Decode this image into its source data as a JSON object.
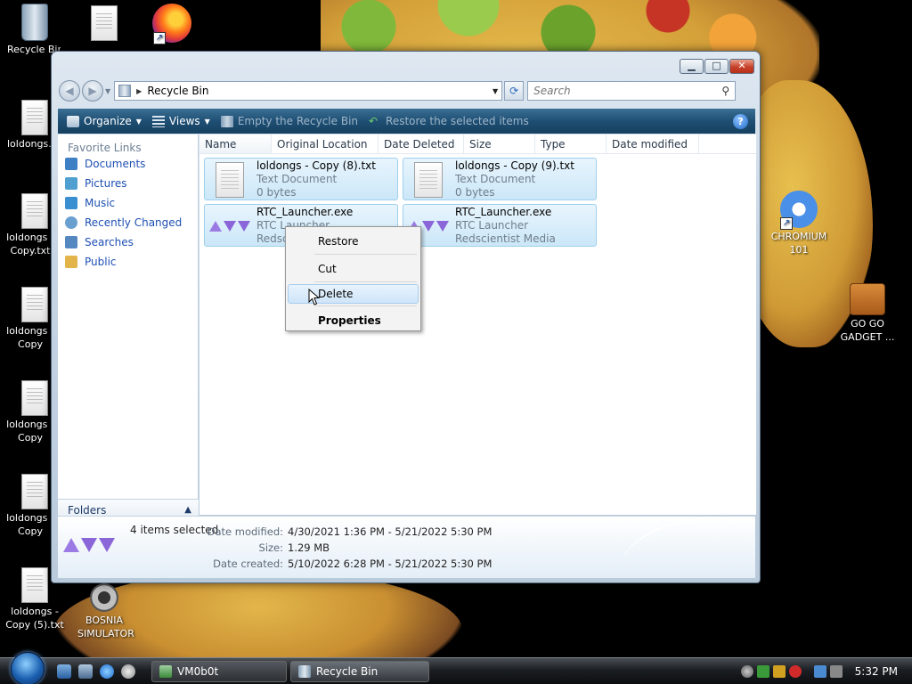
{
  "desktop": {
    "icons": [
      {
        "label": "Recycle Bin"
      },
      {
        "label": "loldongs.txt"
      },
      {
        "label": "loldongs - Copy.txt"
      },
      {
        "label": "loldongs - Copy (2).txt"
      },
      {
        "label": "loldongs - Copy (3).txt"
      },
      {
        "label": "loldongs - Copy (4).txt"
      },
      {
        "label": "loldongs - Copy (5).txt"
      },
      {
        "label": "BOSNIA SIMULATOR"
      },
      {
        "label": "CHROMIUM 101"
      },
      {
        "label": "GO GO GADGET ..."
      }
    ]
  },
  "window": {
    "title": "Recycle Bin",
    "controls": {
      "minimize": "▁",
      "maximize": "□",
      "close": "✕"
    },
    "address": {
      "location": "Recycle Bin"
    },
    "search": {
      "placeholder": "Search"
    },
    "toolbar": {
      "organize": "Organize",
      "views": "Views",
      "empty": "Empty the Recycle Bin",
      "restore": "Restore the selected items",
      "help": "?"
    },
    "nav_pane": {
      "title": "Favorite Links",
      "items": [
        {
          "label": "Documents",
          "color": "#3f7fc4"
        },
        {
          "label": "Pictures",
          "color": "#4f9fd0"
        },
        {
          "label": "Music",
          "color": "#3a8fd0"
        },
        {
          "label": "Recently Changed",
          "color": "#6aa0cf"
        },
        {
          "label": "Searches",
          "color": "#5588c0"
        },
        {
          "label": "Public",
          "color": "#e2b44a"
        }
      ],
      "folders_label": "Folders"
    },
    "columns": [
      "Name",
      "Original Location",
      "Date Deleted",
      "Size",
      "Type",
      "Date modified"
    ],
    "files": [
      {
        "name": "loldongs - Copy (8).txt",
        "type": "Text Document",
        "detail": "0 bytes"
      },
      {
        "name": "loldongs - Copy (9).txt",
        "type": "Text Document",
        "detail": "0 bytes"
      },
      {
        "name": "RTC_Launcher.exe",
        "type": "RTC Launcher",
        "detail": "Redscientist Media"
      },
      {
        "name": "RTC_Launcher.exe",
        "type": "RTC Launcher",
        "detail": "Redscientist Media"
      }
    ],
    "details": {
      "count": "4 items selected",
      "rows": [
        {
          "label": "Date modified:",
          "value": "4/30/2021 1:36 PM - 5/21/2022 5:30 PM"
        },
        {
          "label": "Size:",
          "value": "1.29 MB"
        },
        {
          "label": "Date created:",
          "value": "5/10/2022 6:28 PM - 5/21/2022 5:30 PM"
        }
      ]
    }
  },
  "context_menu": {
    "items": [
      "Restore",
      "Cut",
      "Delete",
      "Properties"
    ],
    "hovered": "Delete"
  },
  "taskbar": {
    "tasks": [
      {
        "label": "VM0b0t"
      },
      {
        "label": "Recycle Bin"
      }
    ],
    "clock": "5:32 PM"
  },
  "colors": {
    "accent": "#1e50b3",
    "toolbar": "#1f4f74",
    "selection": "#cbe7f8"
  }
}
